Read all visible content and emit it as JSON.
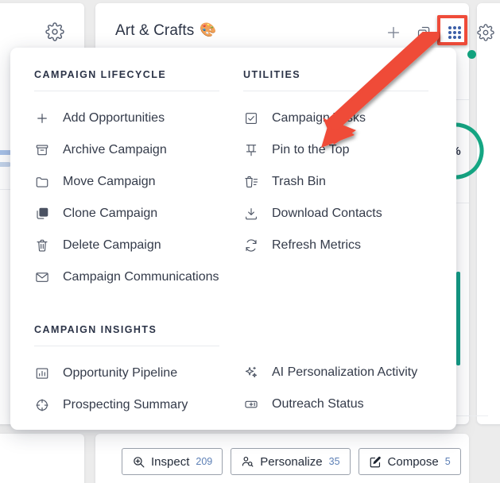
{
  "header": {
    "title": "Art & Crafts",
    "title_emoji": "🎨",
    "left_gear_icon": "gear-icon",
    "actions": [
      {
        "name": "add-icon",
        "label": "+"
      },
      {
        "name": "copy-icon",
        "label": ""
      },
      {
        "name": "grid-apps-icon",
        "label": ""
      },
      {
        "name": "settings-gear-icon",
        "label": ""
      }
    ]
  },
  "highlight": {
    "target": "grid-apps-icon",
    "border_color": "#ef4b39"
  },
  "annotation": {
    "arrow_color": "#ef4b39",
    "points_from": "grid-apps-icon",
    "points_to": "Pin to the Top"
  },
  "status": {
    "dot_color": "#13a37f",
    "ring_percent_label": "%",
    "ring_color": "#15a683",
    "accent_bar_color": "#13a089"
  },
  "menu": {
    "sections": [
      {
        "id": "campaign-lifecycle",
        "title": "Campaign Lifecycle",
        "items": [
          {
            "icon": "plus-icon",
            "label": "Add Opportunities"
          },
          {
            "icon": "archive-icon",
            "label": "Archive Campaign"
          },
          {
            "icon": "folder-icon",
            "label": "Move Campaign"
          },
          {
            "icon": "clone-icon",
            "label": "Clone Campaign"
          },
          {
            "icon": "trash-icon",
            "label": "Delete Campaign"
          },
          {
            "icon": "envelope-icon",
            "label": "Campaign Communications"
          }
        ]
      },
      {
        "id": "utilities",
        "title": "Utilities",
        "items": [
          {
            "icon": "checkbox-icon",
            "label": "Campaign Tasks"
          },
          {
            "icon": "pin-icon",
            "label": "Pin to the Top"
          },
          {
            "icon": "trash-list-icon",
            "label": "Trash Bin"
          },
          {
            "icon": "download-icon",
            "label": "Download Contacts"
          },
          {
            "icon": "refresh-icon",
            "label": "Refresh Metrics"
          }
        ]
      },
      {
        "id": "campaign-insights",
        "title": "Campaign Insights",
        "items_left": [
          {
            "icon": "bar-chart-icon",
            "label": "Opportunity Pipeline"
          },
          {
            "icon": "target-icon",
            "label": "Prospecting Summary"
          }
        ],
        "items_right": [
          {
            "icon": "sparkle-icon",
            "label": "AI Personalization Activity"
          },
          {
            "icon": "megaphone-icon",
            "label": "Outreach Status"
          }
        ]
      }
    ]
  },
  "toolbar": {
    "buttons": [
      {
        "icon": "zoom-in-icon",
        "label": "Inspect",
        "count": "209"
      },
      {
        "icon": "user-edit-icon",
        "label": "Personalize",
        "count": "35"
      },
      {
        "icon": "compose-icon",
        "label": "Compose",
        "count": "5"
      }
    ],
    "count_color": "#5c7fb5"
  }
}
